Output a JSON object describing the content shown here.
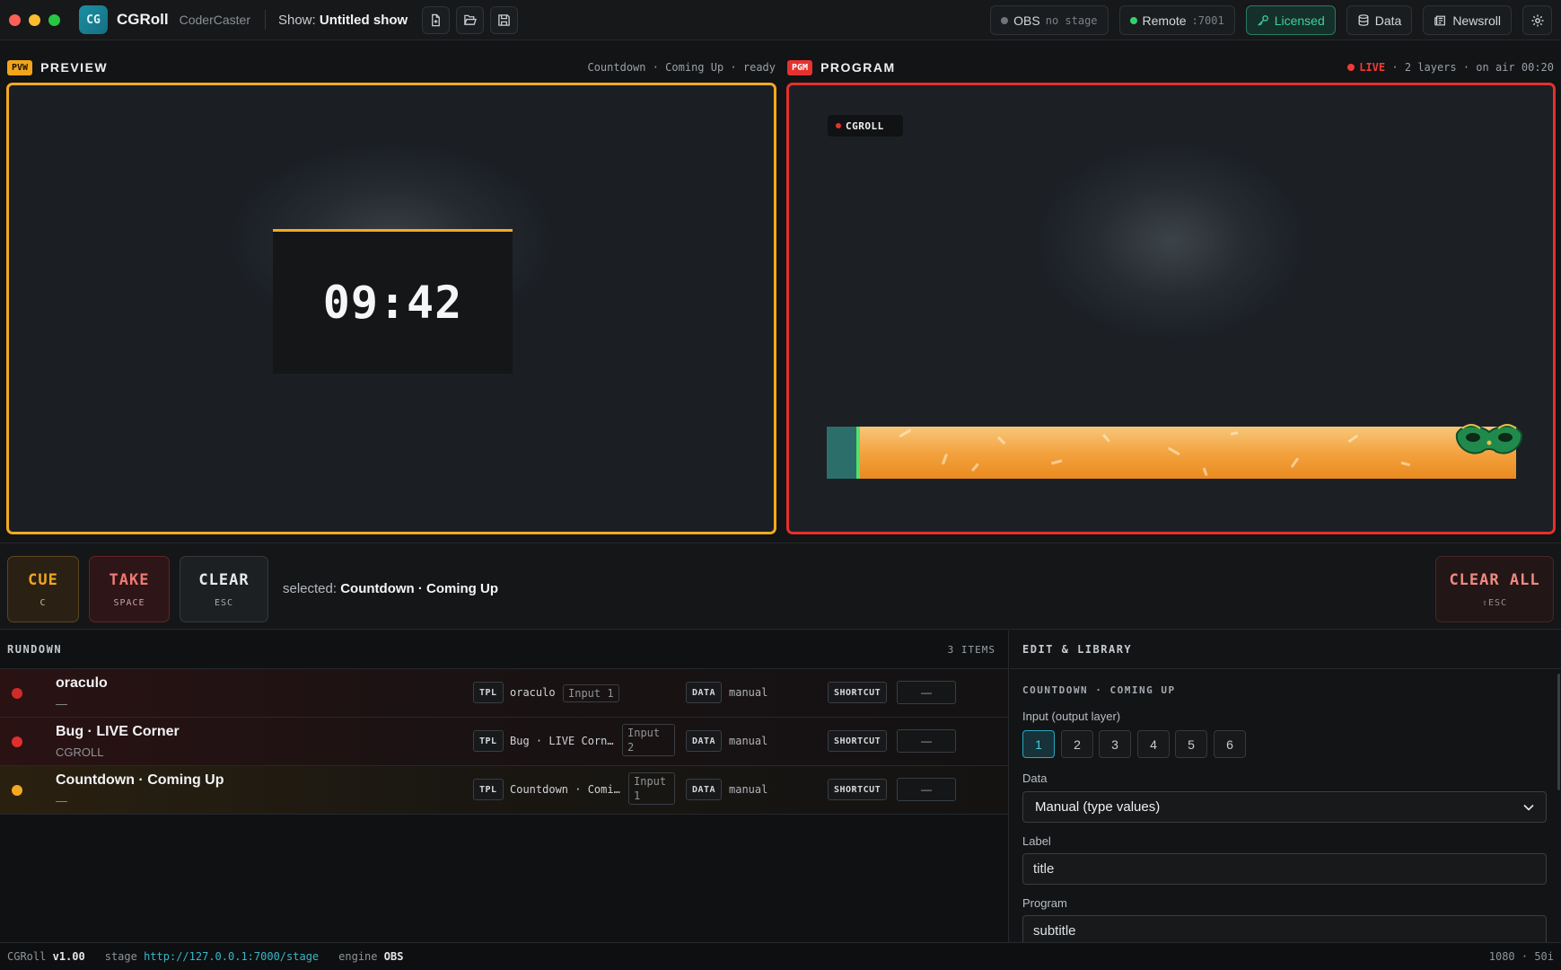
{
  "app": {
    "logo_text": "CG",
    "name": "CGRoll",
    "subtitle": "CoderCaster",
    "show_prefix": "Show:",
    "show_name": "Untitled show"
  },
  "toolbar": {
    "obs_label": "OBS",
    "obs_status": "no stage",
    "remote_label": "Remote",
    "remote_port": ":7001",
    "licensed_label": "Licensed",
    "data_label": "Data",
    "newsroll_label": "Newsroll"
  },
  "preview": {
    "tag": "PVW",
    "title": "PREVIEW",
    "meta": "Countdown · Coming Up · ready",
    "countdown": "09:42"
  },
  "program": {
    "tag": "PGM",
    "title": "PROGRAM",
    "live": "LIVE",
    "meta": "· 2 layers · on air 00:20",
    "bug_text": "CGROLL"
  },
  "controls": {
    "cue": "CUE",
    "cue_key": "C",
    "take": "TAKE",
    "take_key": "SPACE",
    "clear": "CLEAR",
    "clear_key": "ESC",
    "clear_all": "CLEAR ALL",
    "clear_all_key": "⇧ESC",
    "selected_prefix": "selected:",
    "selected_value": "Countdown · Coming Up"
  },
  "rundown": {
    "title": "RUNDOWN",
    "count": "3 ITEMS",
    "tpl_label": "TPL",
    "data_label": "DATA",
    "shortcut_label": "SHORTCUT",
    "items": [
      {
        "name": "oraculo",
        "sub": "—",
        "tpl": "oraculo",
        "input": "Input 1",
        "data": "manual",
        "shortcut": "—",
        "state_color": "#d02b2b"
      },
      {
        "name": "Bug · LIVE Corner",
        "sub": "CGROLL",
        "tpl": "Bug · LIVE Corn…",
        "input": "Input 2",
        "data": "manual",
        "shortcut": "—",
        "state_color": "#e0302d"
      },
      {
        "name": "Countdown · Coming Up",
        "sub": "—",
        "tpl": "Countdown · Comi…",
        "input": "Input 1",
        "data": "manual",
        "shortcut": "—",
        "state_color": "#f3a922"
      }
    ]
  },
  "edit": {
    "title": "EDIT & LIBRARY",
    "section": "COUNTDOWN · COMING UP",
    "input_label": "Input (output layer)",
    "inputs": [
      "1",
      "2",
      "3",
      "4",
      "5",
      "6"
    ],
    "input_selected": "1",
    "data_label": "Data",
    "data_value": "Manual (type values)",
    "label_label": "Label",
    "label_value": "title",
    "program_label": "Program",
    "program_value": "subtitle"
  },
  "status": {
    "app": "CGRoll",
    "version": "v1.00",
    "stage_label": "stage",
    "stage_url": "http://127.0.0.1:7000/stage",
    "engine_label": "engine",
    "engine_value": "OBS",
    "resolution": "1080 · 50i"
  }
}
